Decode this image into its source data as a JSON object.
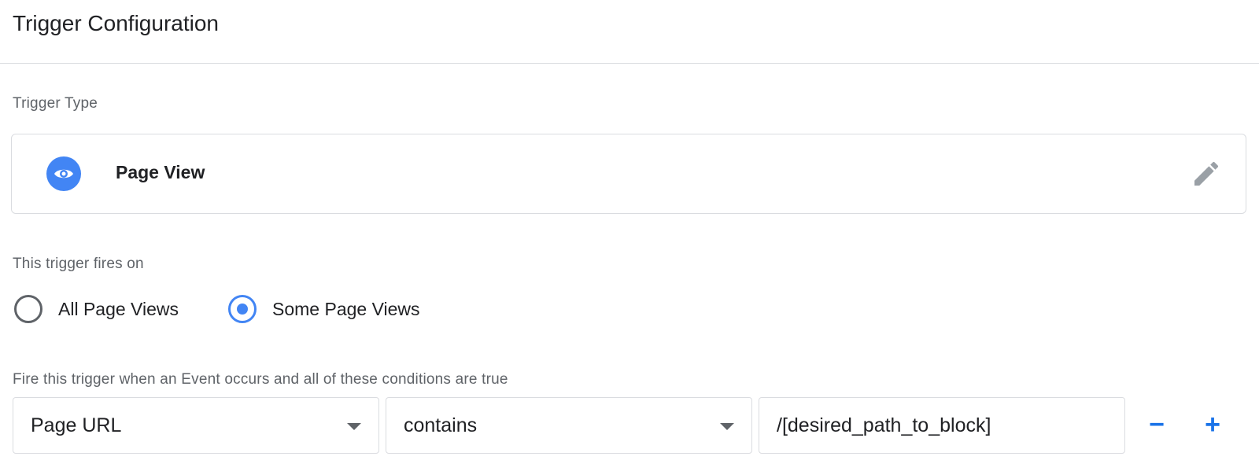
{
  "header": {
    "title": "Trigger Configuration"
  },
  "trigger_type": {
    "label": "Trigger Type",
    "name": "Page View",
    "icon": "eye-icon",
    "edit_icon": "pencil-icon",
    "accent_color": "#4285f4"
  },
  "fires_on": {
    "label": "This trigger fires on",
    "options": [
      {
        "label": "All Page Views",
        "selected": false
      },
      {
        "label": "Some Page Views",
        "selected": true
      }
    ]
  },
  "conditions": {
    "label": "Fire this trigger when an Event occurs and all of these conditions are true",
    "rows": [
      {
        "variable": "Page URL",
        "operator": "contains",
        "value": "/[desired_path_to_block]",
        "remove_label": "−",
        "add_label": "+"
      }
    ]
  }
}
